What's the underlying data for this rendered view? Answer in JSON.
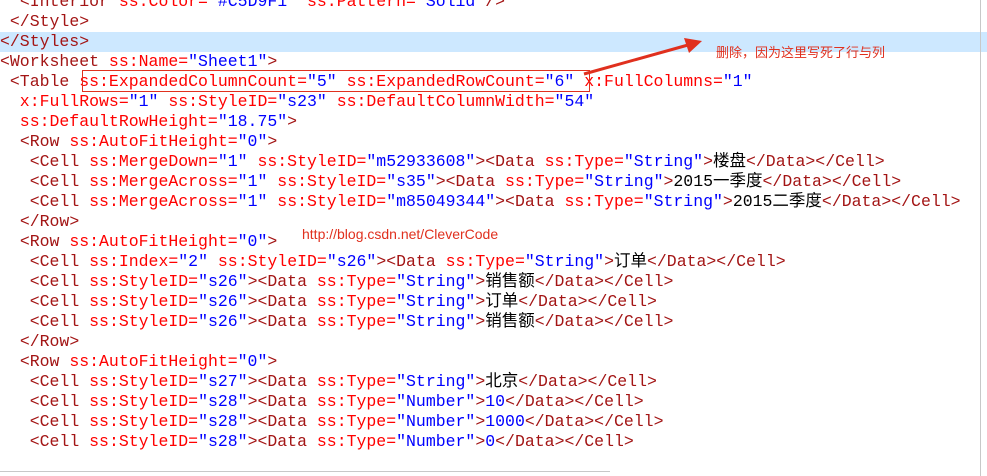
{
  "colors": {
    "tag": "#a31515",
    "attr": "#ff0000",
    "value": "#0000ff",
    "text": "#000000",
    "highlight": "#cde8ff",
    "annotation": "#e0301e"
  },
  "lines": [
    {
      "segments": [
        {
          "t": "  ",
          "c": "text"
        },
        {
          "t": "<Interior",
          "c": "tag"
        },
        {
          "t": " ss:Color=",
          "c": "attr"
        },
        {
          "t": "\"#C5D9F1\"",
          "c": "value"
        },
        {
          "t": " ss:Pattern=",
          "c": "attr"
        },
        {
          "t": "\"Solid\"",
          "c": "value"
        },
        {
          "t": "/>",
          "c": "tag"
        }
      ]
    },
    {
      "segments": [
        {
          "t": " ",
          "c": "text"
        },
        {
          "t": "</Style>",
          "c": "tag"
        }
      ]
    },
    {
      "highlight": true,
      "segments": [
        {
          "t": "</Styles>",
          "c": "tag"
        }
      ]
    },
    {
      "segments": [
        {
          "t": "<Worksheet",
          "c": "tag"
        },
        {
          "t": " ss:Name=",
          "c": "attr"
        },
        {
          "t": "\"Sheet1\"",
          "c": "value"
        },
        {
          "t": ">",
          "c": "tag"
        }
      ]
    },
    {
      "segments": [
        {
          "t": " ",
          "c": "text"
        },
        {
          "t": "<Table",
          "c": "tag"
        },
        {
          "t": " ss:ExpandedColumnCount=",
          "c": "attr"
        },
        {
          "t": "\"5\"",
          "c": "value"
        },
        {
          "t": " ss:ExpandedRowCount=",
          "c": "attr"
        },
        {
          "t": "\"6\"",
          "c": "value"
        },
        {
          "t": " x:FullColumns=",
          "c": "attr"
        },
        {
          "t": "\"1\"",
          "c": "value"
        }
      ]
    },
    {
      "segments": [
        {
          "t": "  x:FullRows=",
          "c": "attr"
        },
        {
          "t": "\"1\"",
          "c": "value"
        },
        {
          "t": " ss:StyleID=",
          "c": "attr"
        },
        {
          "t": "\"s23\"",
          "c": "value"
        },
        {
          "t": " ss:DefaultColumnWidth=",
          "c": "attr"
        },
        {
          "t": "\"54\"",
          "c": "value"
        }
      ]
    },
    {
      "segments": [
        {
          "t": "  ss:DefaultRowHeight=",
          "c": "attr"
        },
        {
          "t": "\"18.75\"",
          "c": "value"
        },
        {
          "t": ">",
          "c": "tag"
        }
      ]
    },
    {
      "segments": [
        {
          "t": "  ",
          "c": "text"
        },
        {
          "t": "<Row",
          "c": "tag"
        },
        {
          "t": " ss:AutoFitHeight=",
          "c": "attr"
        },
        {
          "t": "\"0\"",
          "c": "value"
        },
        {
          "t": ">",
          "c": "tag"
        }
      ]
    },
    {
      "segments": [
        {
          "t": "   ",
          "c": "text"
        },
        {
          "t": "<Cell",
          "c": "tag"
        },
        {
          "t": " ss:MergeDown=",
          "c": "attr"
        },
        {
          "t": "\"1\"",
          "c": "value"
        },
        {
          "t": " ss:StyleID=",
          "c": "attr"
        },
        {
          "t": "\"m52933608\"",
          "c": "value"
        },
        {
          "t": "><Data",
          "c": "tag"
        },
        {
          "t": " ss:Type=",
          "c": "attr"
        },
        {
          "t": "\"String\"",
          "c": "value"
        },
        {
          "t": ">",
          "c": "tag"
        },
        {
          "t": "楼盘",
          "c": "text"
        },
        {
          "t": "</Data></Cell>",
          "c": "tag"
        }
      ]
    },
    {
      "segments": [
        {
          "t": "   ",
          "c": "text"
        },
        {
          "t": "<Cell",
          "c": "tag"
        },
        {
          "t": " ss:MergeAcross=",
          "c": "attr"
        },
        {
          "t": "\"1\"",
          "c": "value"
        },
        {
          "t": " ss:StyleID=",
          "c": "attr"
        },
        {
          "t": "\"s35\"",
          "c": "value"
        },
        {
          "t": "><Data",
          "c": "tag"
        },
        {
          "t": " ss:Type=",
          "c": "attr"
        },
        {
          "t": "\"String\"",
          "c": "value"
        },
        {
          "t": ">",
          "c": "tag"
        },
        {
          "t": "2015一季度",
          "c": "text"
        },
        {
          "t": "</Data></Cell>",
          "c": "tag"
        }
      ]
    },
    {
      "segments": [
        {
          "t": "   ",
          "c": "text"
        },
        {
          "t": "<Cell",
          "c": "tag"
        },
        {
          "t": " ss:MergeAcross=",
          "c": "attr"
        },
        {
          "t": "\"1\"",
          "c": "value"
        },
        {
          "t": " ss:StyleID=",
          "c": "attr"
        },
        {
          "t": "\"m85049344\"",
          "c": "value"
        },
        {
          "t": "><Data",
          "c": "tag"
        },
        {
          "t": " ss:Type=",
          "c": "attr"
        },
        {
          "t": "\"String\"",
          "c": "value"
        },
        {
          "t": ">",
          "c": "tag"
        },
        {
          "t": "2015二季度",
          "c": "text"
        },
        {
          "t": "</Data></Cell>",
          "c": "tag"
        }
      ]
    },
    {
      "segments": [
        {
          "t": "  ",
          "c": "text"
        },
        {
          "t": "</Row>",
          "c": "tag"
        }
      ]
    },
    {
      "segments": [
        {
          "t": "  ",
          "c": "text"
        },
        {
          "t": "<Row",
          "c": "tag"
        },
        {
          "t": " ss:AutoFitHeight=",
          "c": "attr"
        },
        {
          "t": "\"0\"",
          "c": "value"
        },
        {
          "t": ">",
          "c": "tag"
        }
      ]
    },
    {
      "segments": [
        {
          "t": "   ",
          "c": "text"
        },
        {
          "t": "<Cell",
          "c": "tag"
        },
        {
          "t": " ss:Index=",
          "c": "attr"
        },
        {
          "t": "\"2\"",
          "c": "value"
        },
        {
          "t": " ss:StyleID=",
          "c": "attr"
        },
        {
          "t": "\"s26\"",
          "c": "value"
        },
        {
          "t": "><Data",
          "c": "tag"
        },
        {
          "t": " ss:Type=",
          "c": "attr"
        },
        {
          "t": "\"String\"",
          "c": "value"
        },
        {
          "t": ">",
          "c": "tag"
        },
        {
          "t": "订单",
          "c": "text"
        },
        {
          "t": "</Data></Cell>",
          "c": "tag"
        }
      ]
    },
    {
      "segments": [
        {
          "t": "   ",
          "c": "text"
        },
        {
          "t": "<Cell",
          "c": "tag"
        },
        {
          "t": " ss:StyleID=",
          "c": "attr"
        },
        {
          "t": "\"s26\"",
          "c": "value"
        },
        {
          "t": "><Data",
          "c": "tag"
        },
        {
          "t": " ss:Type=",
          "c": "attr"
        },
        {
          "t": "\"String\"",
          "c": "value"
        },
        {
          "t": ">",
          "c": "tag"
        },
        {
          "t": "销售额",
          "c": "text"
        },
        {
          "t": "</Data></Cell>",
          "c": "tag"
        }
      ]
    },
    {
      "segments": [
        {
          "t": "   ",
          "c": "text"
        },
        {
          "t": "<Cell",
          "c": "tag"
        },
        {
          "t": " ss:StyleID=",
          "c": "attr"
        },
        {
          "t": "\"s26\"",
          "c": "value"
        },
        {
          "t": "><Data",
          "c": "tag"
        },
        {
          "t": " ss:Type=",
          "c": "attr"
        },
        {
          "t": "\"String\"",
          "c": "value"
        },
        {
          "t": ">",
          "c": "tag"
        },
        {
          "t": "订单",
          "c": "text"
        },
        {
          "t": "</Data></Cell>",
          "c": "tag"
        }
      ]
    },
    {
      "segments": [
        {
          "t": "   ",
          "c": "text"
        },
        {
          "t": "<Cell",
          "c": "tag"
        },
        {
          "t": " ss:StyleID=",
          "c": "attr"
        },
        {
          "t": "\"s26\"",
          "c": "value"
        },
        {
          "t": "><Data",
          "c": "tag"
        },
        {
          "t": " ss:Type=",
          "c": "attr"
        },
        {
          "t": "\"String\"",
          "c": "value"
        },
        {
          "t": ">",
          "c": "tag"
        },
        {
          "t": "销售额",
          "c": "text"
        },
        {
          "t": "</Data></Cell>",
          "c": "tag"
        }
      ]
    },
    {
      "segments": [
        {
          "t": "  ",
          "c": "text"
        },
        {
          "t": "</Row>",
          "c": "tag"
        }
      ]
    },
    {
      "segments": [
        {
          "t": "  ",
          "c": "text"
        },
        {
          "t": "<Row",
          "c": "tag"
        },
        {
          "t": " ss:AutoFitHeight=",
          "c": "attr"
        },
        {
          "t": "\"0\"",
          "c": "value"
        },
        {
          "t": ">",
          "c": "tag"
        }
      ]
    },
    {
      "segments": [
        {
          "t": "   ",
          "c": "text"
        },
        {
          "t": "<Cell",
          "c": "tag"
        },
        {
          "t": " ss:StyleID=",
          "c": "attr"
        },
        {
          "t": "\"s27\"",
          "c": "value"
        },
        {
          "t": "><Data",
          "c": "tag"
        },
        {
          "t": " ss:Type=",
          "c": "attr"
        },
        {
          "t": "\"String\"",
          "c": "value"
        },
        {
          "t": ">",
          "c": "tag"
        },
        {
          "t": "北京",
          "c": "text"
        },
        {
          "t": "</Data></Cell>",
          "c": "tag"
        }
      ]
    },
    {
      "segments": [
        {
          "t": "   ",
          "c": "text"
        },
        {
          "t": "<Cell",
          "c": "tag"
        },
        {
          "t": " ss:StyleID=",
          "c": "attr"
        },
        {
          "t": "\"s28\"",
          "c": "value"
        },
        {
          "t": "><Data",
          "c": "tag"
        },
        {
          "t": " ss:Type=",
          "c": "attr"
        },
        {
          "t": "\"Number\"",
          "c": "value"
        },
        {
          "t": ">",
          "c": "tag"
        },
        {
          "t": "10",
          "c": "value"
        },
        {
          "t": "</Data></Cell>",
          "c": "tag"
        }
      ]
    },
    {
      "segments": [
        {
          "t": "   ",
          "c": "text"
        },
        {
          "t": "<Cell",
          "c": "tag"
        },
        {
          "t": " ss:StyleID=",
          "c": "attr"
        },
        {
          "t": "\"s28\"",
          "c": "value"
        },
        {
          "t": "><Data",
          "c": "tag"
        },
        {
          "t": " ss:Type=",
          "c": "attr"
        },
        {
          "t": "\"Number\"",
          "c": "value"
        },
        {
          "t": ">",
          "c": "tag"
        },
        {
          "t": "1000",
          "c": "value"
        },
        {
          "t": "</Data></Cell>",
          "c": "tag"
        }
      ]
    },
    {
      "segments": [
        {
          "t": "   ",
          "c": "text"
        },
        {
          "t": "<Cell",
          "c": "tag"
        },
        {
          "t": " ss:StyleID=",
          "c": "attr"
        },
        {
          "t": "\"s28\"",
          "c": "value"
        },
        {
          "t": "><Data",
          "c": "tag"
        },
        {
          "t": " ss:Type=",
          "c": "attr"
        },
        {
          "t": "\"Number\"",
          "c": "value"
        },
        {
          "t": ">",
          "c": "tag"
        },
        {
          "t": "0",
          "c": "value"
        },
        {
          "t": "</Data></Cell>",
          "c": "tag"
        }
      ]
    }
  ],
  "annotation": {
    "callout_text": "删除，因为这里写死了行与列",
    "watermark_link": "http://blog.csdn.net/CleverCode"
  }
}
